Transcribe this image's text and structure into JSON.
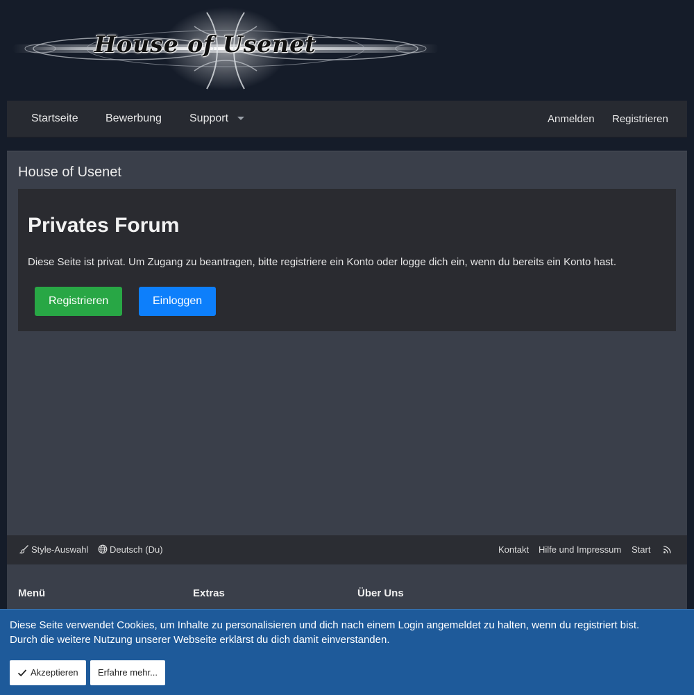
{
  "logo": {
    "text": "House of Usenet"
  },
  "nav": {
    "items": [
      "Startseite",
      "Bewerbung",
      "Support"
    ],
    "login": "Anmelden",
    "register": "Registrieren"
  },
  "main": {
    "title": "House of Usenet",
    "heading": "Privates Forum",
    "text": "Diese Seite ist privat. Um Zugang zu beantragen, bitte registriere ein Konto oder logge dich ein, wenn du bereits ein Konto hast.",
    "register_button": "Registrieren",
    "login_button": "Einloggen"
  },
  "footer": {
    "style_chooser": "Style-Auswahl",
    "language": "Deutsch (Du)",
    "links": [
      "Kontakt",
      "Hilfe und Impressum",
      "Start"
    ],
    "columns": [
      "Menü",
      "Extras",
      "Über Uns"
    ]
  },
  "cookie": {
    "line1": "Diese Seite verwendet Cookies, um Inhalte zu personalisieren und dich nach einem Login angemeldet zu halten, wenn du registriert bist.",
    "line2": "Durch die weitere Nutzung unserer Webseite erklärst du dich damit einverstanden.",
    "accept": "Akzeptieren",
    "learn_more": "Erfahre mehr..."
  },
  "colors": {
    "page_background": "#151c29",
    "nav_background": "#272a31",
    "content_background": "#3a3f4a",
    "block_background": "#2a2b30",
    "register_green": "#28a745",
    "login_blue": "#0d7ffb",
    "cookie_blue": "#1e5a9a"
  },
  "icons": [
    "menu-caret-icon",
    "paintbrush-icon",
    "globe-icon",
    "rss-icon",
    "checkmark-icon"
  ]
}
